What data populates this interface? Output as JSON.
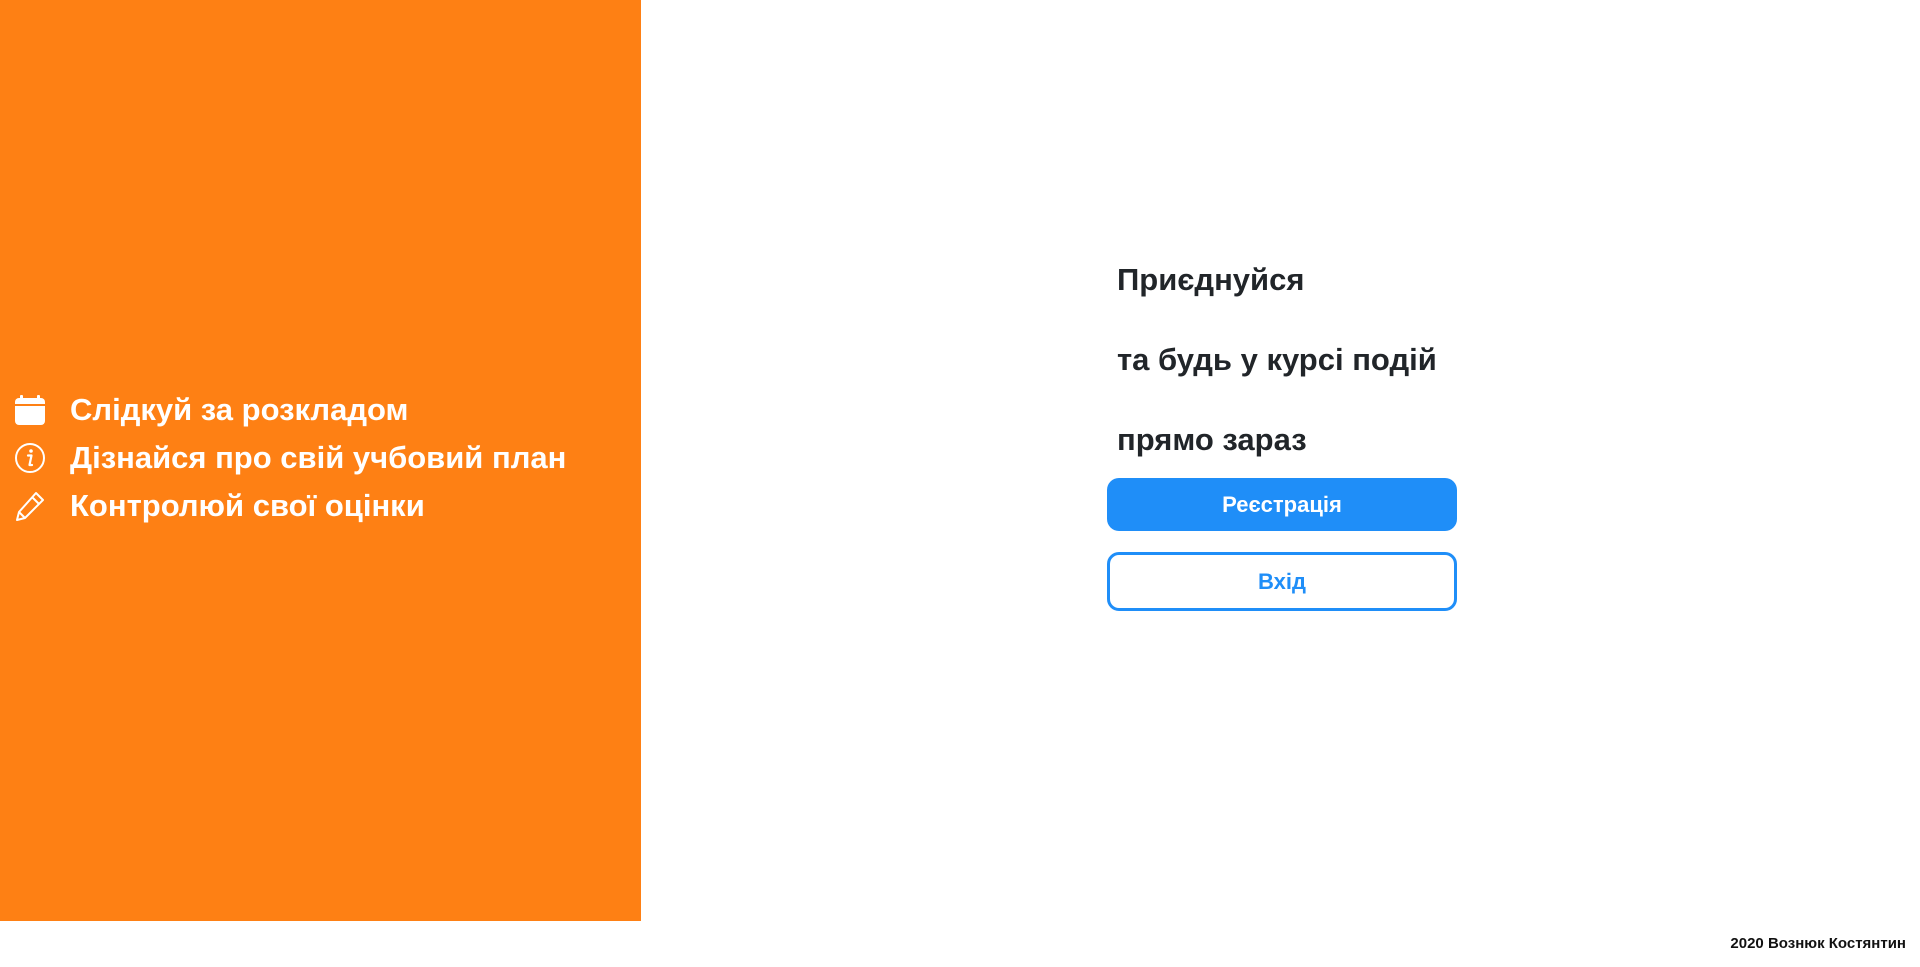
{
  "promo": {
    "background_color": "#fe8014",
    "features": [
      {
        "icon": "calendar-icon",
        "label": "Слідкуй за розкладом"
      },
      {
        "icon": "info-icon",
        "label": "Дізнайся про свій учбовий план"
      },
      {
        "icon": "pencil-icon",
        "label": "Контролюй свої оцінки"
      }
    ]
  },
  "cta": {
    "lines": [
      "Приєднуйся",
      "та будь у курсі подій",
      "прямо зараз"
    ],
    "register_label": "Реєстрація",
    "login_label": "Вхід",
    "accent_color": "#1f8ef8"
  },
  "footer": {
    "text": "2020 Вознюк Костянтин"
  }
}
